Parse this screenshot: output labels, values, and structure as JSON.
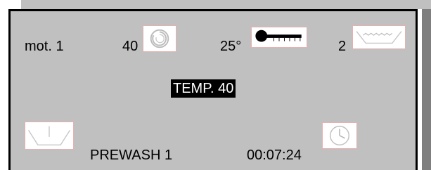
{
  "row1": {
    "motor_label": "mot. 1",
    "speed_value": "40",
    "speed_icon": "spin-icon",
    "temperature_value": "25°",
    "temperature_icon": "thermometer-icon",
    "level_value": "2",
    "level_icon": "water-level-icon"
  },
  "status": {
    "highlight_text": "TEMP. 40",
    "highlight_bg": "#000000",
    "highlight_fg": "#ffffff"
  },
  "row3": {
    "tub_icon": "drum-icon",
    "phase_label": "PREWASH 1",
    "time_remaining": "00:07:24",
    "clock_icon": "clock-icon"
  },
  "colors": {
    "panel_bg": "#c0c0c0",
    "shadow": "#7f7f7f",
    "border": "#000000"
  }
}
